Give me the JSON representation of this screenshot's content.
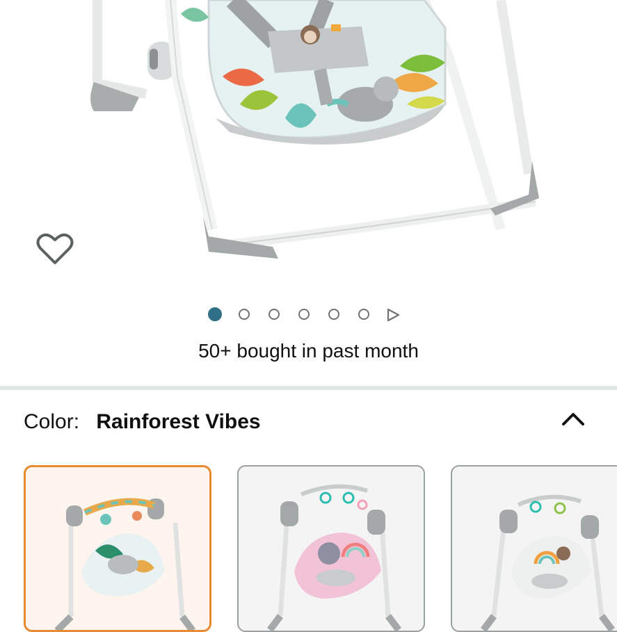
{
  "gallery": {
    "image_alt": "Portable baby swing product photo",
    "wishlist_icon": "heart-outline-icon",
    "dot_count": 6,
    "active_dot": 0,
    "next_icon": "play-triangle-icon"
  },
  "social_proof": {
    "text": "50+ bought in past month"
  },
  "variant": {
    "label": "Color:",
    "value": "Rainforest Vibes",
    "collapse_icon": "chevron-up-icon"
  },
  "swatches": [
    {
      "name": "rainforest",
      "selected": true
    },
    {
      "name": "pink",
      "selected": false
    },
    {
      "name": "neutral",
      "selected": false
    }
  ],
  "colors": {
    "accent_dot": "#2f6f87",
    "selected_border": "#e88a2f"
  }
}
